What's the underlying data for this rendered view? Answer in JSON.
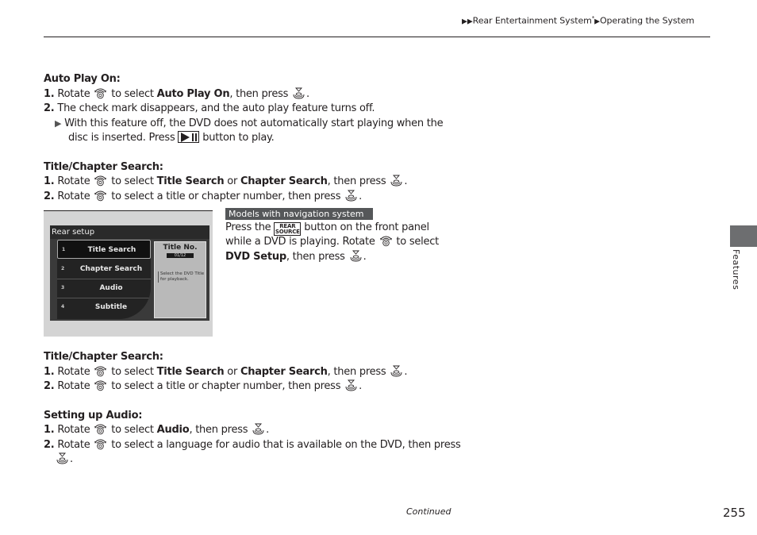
{
  "header": {
    "breadcrumb": [
      {
        "label": "Rear Entertainment System",
        "suffix": "*"
      },
      {
        "label": "Operating the System"
      }
    ]
  },
  "sections": {
    "auto_play": {
      "heading": "Auto Play On:",
      "step1": {
        "num": "1.",
        "pre": "Rotate",
        "mid": "to select",
        "bold": "Auto Play On",
        "post": ", then press",
        "end": "."
      },
      "step2": {
        "num": "2.",
        "text": "The check mark disappears, and the auto play feature turns off."
      },
      "note_line1": "With this feature off, the DVD does not automatically start playing when the",
      "note_line2_pre": "disc is inserted. Press",
      "note_line2_post": "button to play."
    },
    "title_chapter_1": {
      "heading": "Title/Chapter Search:",
      "step1": {
        "num": "1.",
        "pre": "Rotate",
        "mid": "to select",
        "bold1": "Title Search",
        "or": "or",
        "bold2": "Chapter Search",
        "post": ", then press",
        "end": "."
      },
      "step2": {
        "num": "2.",
        "pre": "Rotate",
        "post": "to select a title or chapter number, then press",
        "end": "."
      }
    },
    "nav_note": {
      "badge": "Models with navigation system",
      "line1_pre": "Press the",
      "line1_post": "button on the front panel",
      "rear_button": [
        "REAR",
        "SOURCE"
      ],
      "line2_pre": "while a DVD is playing. Rotate",
      "line2_post": "to select",
      "line3_bold": "DVD Setup",
      "line3_post": ", then press",
      "end": "."
    },
    "screen": {
      "title": "Rear setup",
      "menu": [
        {
          "num": "1",
          "label": "Title Search",
          "selected": true
        },
        {
          "num": "2",
          "label": "Chapter Search"
        },
        {
          "num": "3",
          "label": "Audio"
        },
        {
          "num": "4",
          "label": "Subtitle"
        }
      ],
      "info_title": "Title No.",
      "info_value": "01/12",
      "info_desc": "Select the DVD Title for playback."
    },
    "title_chapter_2": {
      "heading": "Title/Chapter Search:",
      "step1": {
        "num": "1.",
        "pre": "Rotate",
        "mid": "to select",
        "bold1": "Title Search",
        "or": "or",
        "bold2": "Chapter Search",
        "post": ", then press",
        "end": "."
      },
      "step2": {
        "num": "2.",
        "pre": "Rotate",
        "post": "to select a title or chapter number, then press",
        "end": "."
      }
    },
    "audio": {
      "heading": "Setting up Audio:",
      "step1": {
        "num": "1.",
        "pre": "Rotate",
        "mid": "to select",
        "bold": "Audio",
        "post": ", then press",
        "end": "."
      },
      "step2": {
        "num": "2.",
        "pre": "Rotate",
        "post": "to select a language for audio that is available on the DVD, then press",
        "end": "."
      }
    }
  },
  "side_tab": {
    "label": "Features",
    "color": "#6d6e70"
  },
  "footer": {
    "continued": "Continued",
    "page_number": "255"
  }
}
